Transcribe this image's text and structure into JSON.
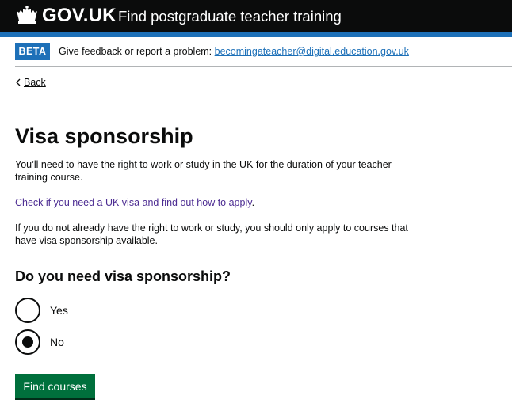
{
  "header": {
    "logo_text": "GOV.UK",
    "service_name": "Find postgraduate teacher training",
    "crown_icon": "crown-icon"
  },
  "phase_banner": {
    "tag": "BETA",
    "text": "Give feedback or report a problem:",
    "link": "becomingateacher@digital.education.gov.uk"
  },
  "back_link": {
    "label": "Back",
    "icon": "chevron-left-icon"
  },
  "main": {
    "title": "Visa sponsorship",
    "paragraph_1": "You’ll need to have the right to work or study in the UK for the duration of your teacher training course.",
    "paragraph_2_link": "Check if you need a UK visa and find out how to apply",
    "paragraph_2_suffix": ".",
    "paragraph_3": "If you do not already have the right to work or study, you should only apply to courses that have visa sponsorship available.",
    "question": "Do you need visa sponsorship?",
    "options": [
      {
        "label": "Yes",
        "selected": false
      },
      {
        "label": "No",
        "selected": true
      }
    ],
    "submit_label": "Find courses"
  },
  "colors": {
    "header_bg": "#0b0c0c",
    "brand_blue": "#1d70b8",
    "button_green": "#00703c",
    "visited_link": "#4c2c92"
  }
}
